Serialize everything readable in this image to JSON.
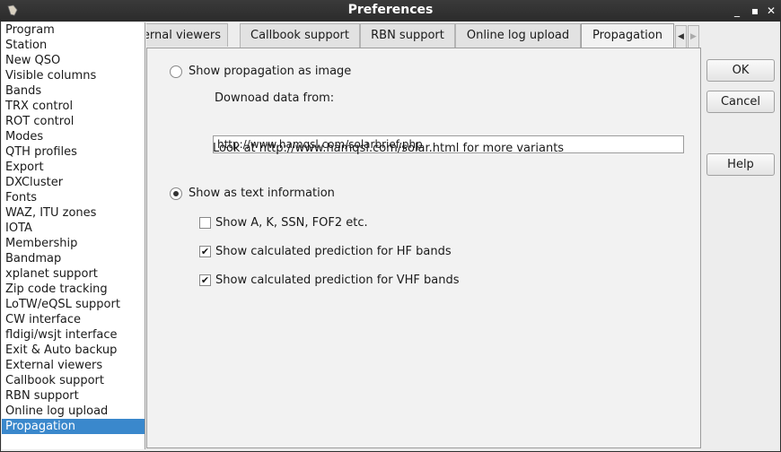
{
  "window": {
    "title": "Preferences"
  },
  "sidebar": {
    "items": [
      "Program",
      "Station",
      "New QSO",
      "Visible columns",
      "Bands",
      "TRX control",
      "ROT control",
      "Modes",
      "QTH profiles",
      "Export",
      "DXCluster",
      "Fonts",
      "WAZ, ITU zones",
      "IOTA",
      "Membership",
      "Bandmap",
      "xplanet support",
      "Zip code tracking",
      "LoTW/eQSL support",
      "CW interface",
      "fldigi/wsjt interface",
      "Exit & Auto backup",
      "External viewers",
      "Callbook support",
      "RBN support",
      "Online log upload",
      "Propagation"
    ],
    "selected": "Propagation"
  },
  "tabs": [
    "External viewers",
    "Callbook support",
    "RBN support",
    "Online log upload",
    "Propagation"
  ],
  "propagation": {
    "image_option": "Show propagation as image",
    "download_label": "Downoad data from:",
    "url_value": "http://www.hamqsl.com/solarbrief.php",
    "more_variants": "Look at http://www.hamqsl.com/solar.html for more variants",
    "text_option": "Show as text information",
    "opt_akssn": "Show A, K, SSN, FOF2 etc.",
    "opt_hf": "Show calculated prediction for HF bands",
    "opt_vhf": "Show calculated prediction for VHF bands"
  },
  "buttons": {
    "ok": "OK",
    "cancel": "Cancel",
    "help": "Help"
  }
}
